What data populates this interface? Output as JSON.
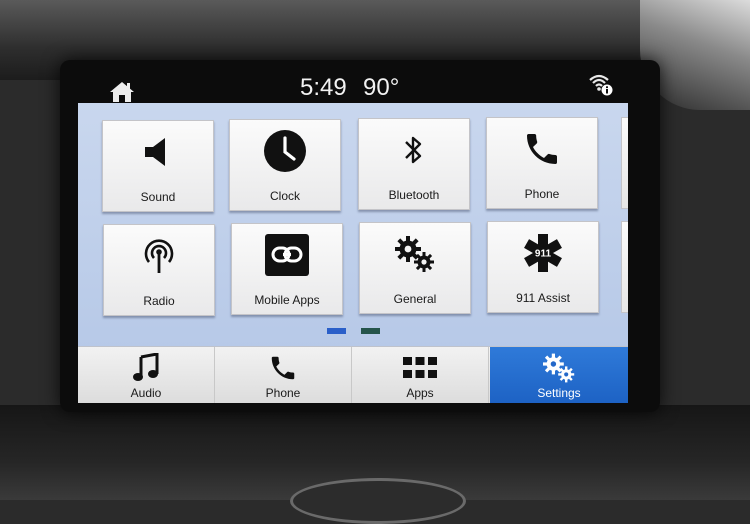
{
  "status_bar": {
    "time": "5:49",
    "temperature": "90°",
    "icons": [
      "home-icon",
      "wifi-info-icon"
    ]
  },
  "grid": {
    "tiles": [
      {
        "label": "Sound",
        "icon": "speaker-icon"
      },
      {
        "label": "Clock",
        "icon": "clock-icon"
      },
      {
        "label": "Bluetooth",
        "icon": "bluetooth-icon"
      },
      {
        "label": "Phone",
        "icon": "phone-icon"
      },
      {
        "label": "Radio",
        "icon": "radio-antenna-icon"
      },
      {
        "label": "Mobile Apps",
        "icon": "link-icon"
      },
      {
        "label": "General",
        "icon": "gears-icon"
      },
      {
        "label": "911 Assist",
        "icon": "star-of-life-icon",
        "badge": "911"
      }
    ],
    "page_indicator": {
      "pages": 2,
      "current": 1
    }
  },
  "nav": {
    "items": [
      {
        "label": "Audio",
        "icon": "music-note-icon"
      },
      {
        "label": "Phone",
        "icon": "phone-icon"
      },
      {
        "label": "Apps",
        "icon": "app-grid-icon"
      },
      {
        "label": "Settings",
        "icon": "gears-icon",
        "active": true
      }
    ]
  },
  "colors": {
    "screen_bg": "#c0d0ea",
    "active_tab": "#2a72d2",
    "page_dot_active": "#2a5fc9",
    "page_dot_inactive": "#25544a"
  }
}
